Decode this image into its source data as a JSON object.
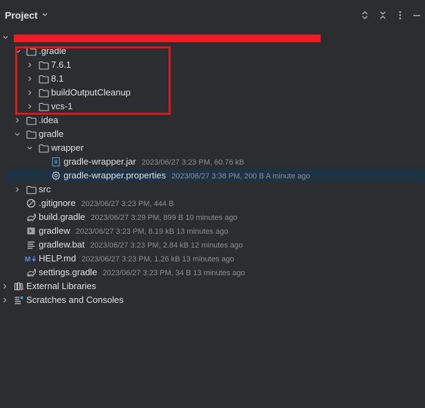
{
  "header": {
    "title": "Project"
  },
  "tree": {
    "root_label": "",
    "gradle_dir": ".gradle",
    "v761": "7.6.1",
    "v81": "8.1",
    "build_output_cleanup": "buildOutputCleanup",
    "vcs1": "vcs-1",
    "idea": ".idea",
    "gradle": "gradle",
    "wrapper": "wrapper",
    "wrapper_jar": {
      "name": "gradle-wrapper.jar",
      "meta": "2023/06/27 3:23 PM, 60.76 kB"
    },
    "wrapper_props": {
      "name": "gradle-wrapper.properties",
      "meta": "2023/06/27 3:38 PM, 200 B A minute ago"
    },
    "src": "src",
    "gitignore": {
      "name": ".gitignore",
      "meta": "2023/06/27 3:23 PM, 444 B"
    },
    "build_gradle": {
      "name": "build.gradle",
      "meta": "2023/06/27 3:29 PM, 899 B 10 minutes ago"
    },
    "gradlew": {
      "name": "gradlew",
      "meta": "2023/06/27 3:23 PM, 8.19 kB 13 minutes ago"
    },
    "gradlew_bat": {
      "name": "gradlew.bat",
      "meta": "2023/06/27 3:23 PM, 2.84 kB 12 minutes ago"
    },
    "help_md": {
      "name": "HELP.md",
      "meta": "2023/06/27 3:23 PM, 1.26 kB 13 minutes ago"
    },
    "settings_gradle": {
      "name": "settings.gradle",
      "meta": "2023/06/27 3:23 PM, 34 B 13 minutes ago"
    },
    "external_libraries": "External Libraries",
    "scratches": "Scratches and Consoles"
  },
  "colors": {
    "background": "#2b2d30",
    "selection": "#1f3244",
    "text": "#dfe1e5",
    "meta_text": "#8c9096",
    "redaction": "#ee1c23",
    "annotation_box": "#e0161d"
  },
  "icons": {
    "folder": "folder-icon",
    "jar": "jar-icon",
    "properties": "gear-icon",
    "ignore": "ignore-icon",
    "gradle": "gradle-icon",
    "shell": "terminal-icon",
    "text": "text-file-icon",
    "markdown": "markdown-icon",
    "library": "library-icon",
    "scratches": "scratches-icon"
  }
}
